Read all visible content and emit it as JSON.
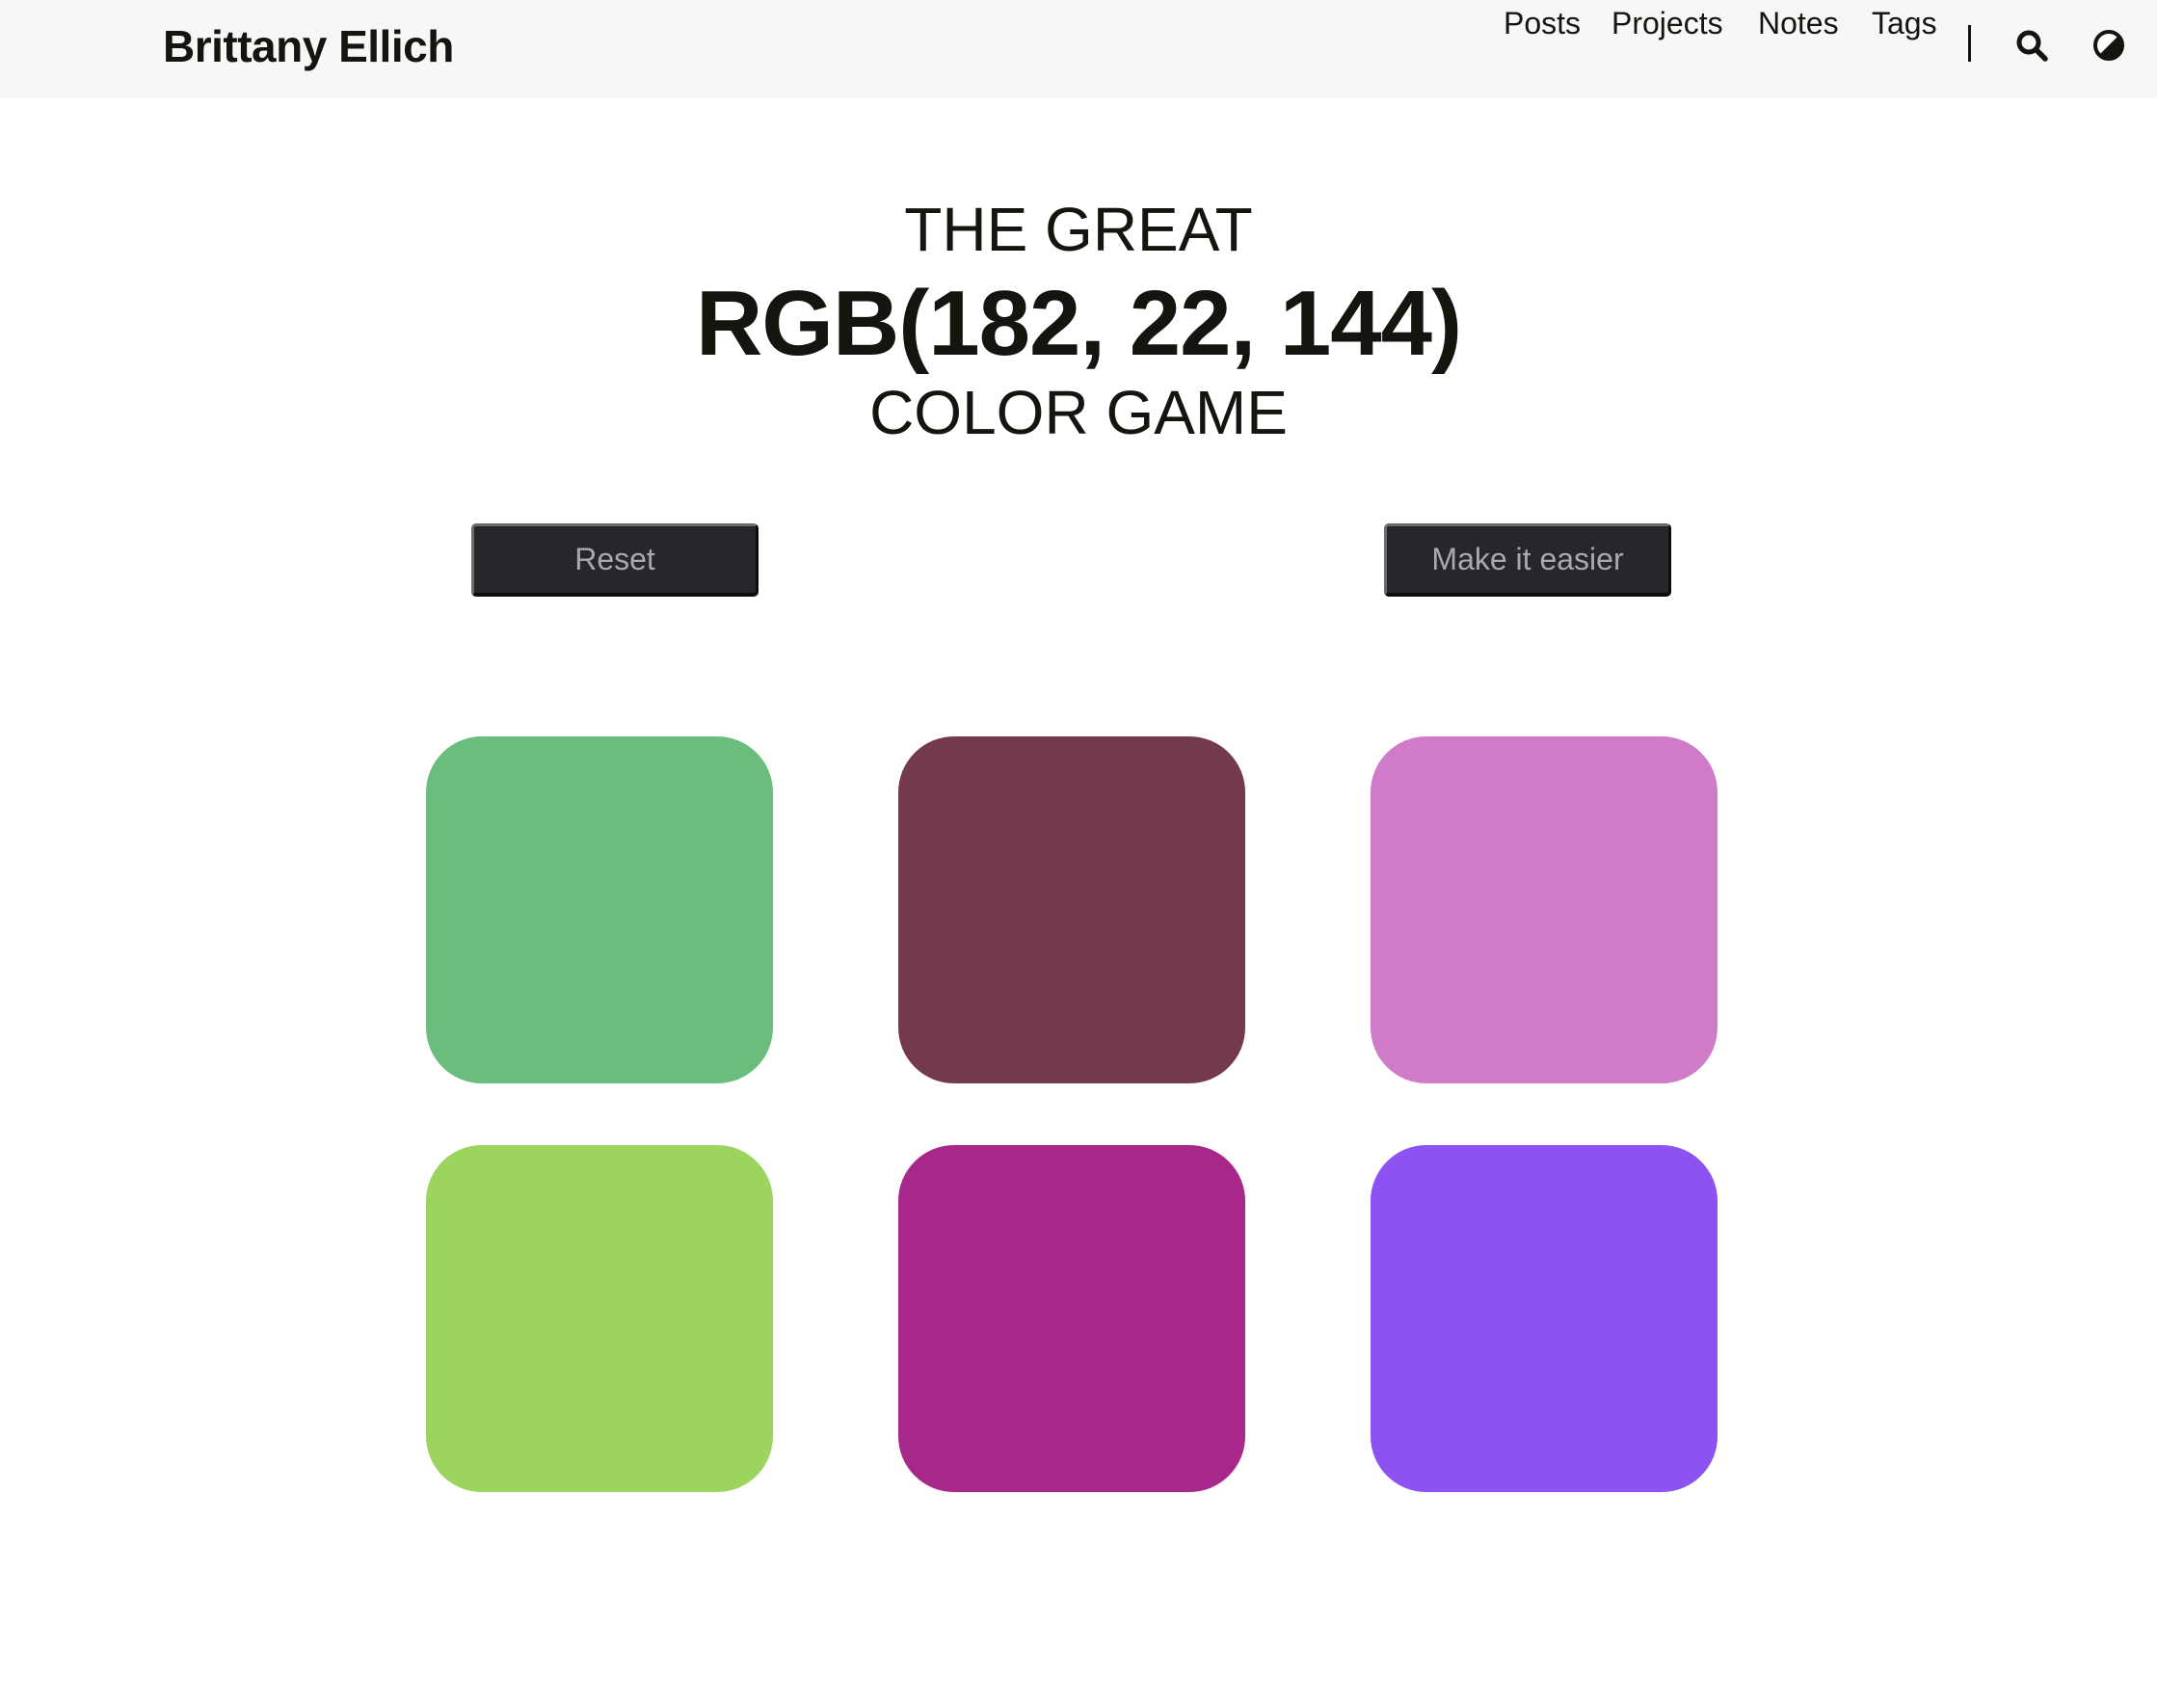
{
  "header": {
    "brand": "Brittany Ellich",
    "nav": [
      {
        "label": "Posts"
      },
      {
        "label": "Projects"
      },
      {
        "label": "Notes"
      },
      {
        "label": "Tags"
      }
    ],
    "icons": {
      "search": "search-icon",
      "theme": "contrast-icon"
    }
  },
  "game": {
    "title_top": "THE GREAT",
    "target_color": "RGB(182, 22, 144)",
    "title_bottom": "COLOR GAME",
    "reset_label": "Reset",
    "easier_label": "Make it easier",
    "squares": [
      {
        "color": "#6bbd7e"
      },
      {
        "color": "#733a4f"
      },
      {
        "color": "#cf7bc8"
      },
      {
        "color": "#9bd55e"
      },
      {
        "color": "#a8288a"
      },
      {
        "color": "#8d52f2"
      }
    ]
  }
}
